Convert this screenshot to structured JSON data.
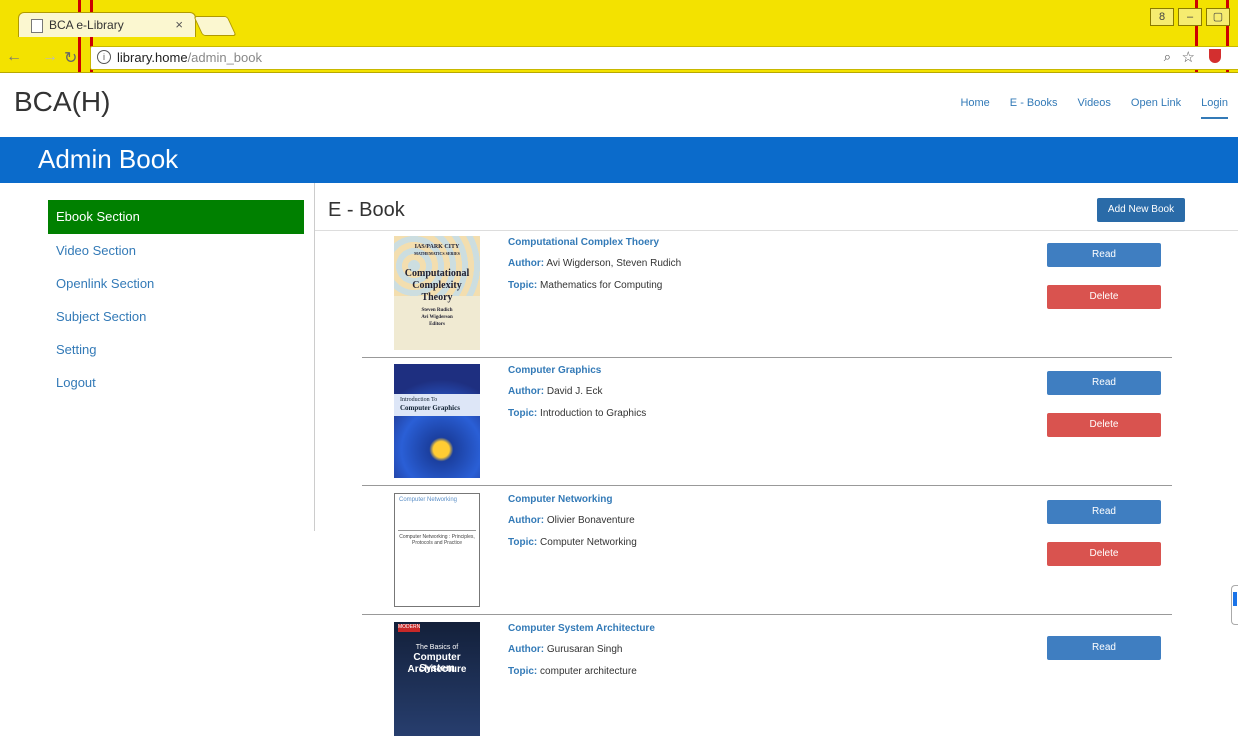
{
  "browser": {
    "tab_title": "BCA e-Library",
    "tab_close": "×",
    "url_host": "library.home",
    "url_path": "/admin_book",
    "info_glyph": "i",
    "window_controls": [
      "8",
      "–",
      "▢"
    ]
  },
  "site": {
    "brand": "BCA(H)",
    "nav": [
      {
        "label": "Home"
      },
      {
        "label": "E - Books"
      },
      {
        "label": "Videos"
      },
      {
        "label": "Open Link"
      },
      {
        "label": "Login"
      }
    ]
  },
  "header": {
    "title": "Admin Book"
  },
  "sidebar": {
    "items": [
      {
        "label": "Ebook Section"
      },
      {
        "label": "Video Section"
      },
      {
        "label": "Openlink Section"
      },
      {
        "label": "Subject Section"
      },
      {
        "label": "Setting"
      },
      {
        "label": "Logout"
      }
    ],
    "active": "Ebook Section"
  },
  "main": {
    "title": "E - Book",
    "add_button": "Add New Book",
    "author_key": "Author:",
    "topic_key": "Topic:",
    "read_label": "Read",
    "delete_label": "Delete",
    "books": [
      {
        "title": "Computational Complex Thoery",
        "author": "Avi Wigderson, Steven Rudich",
        "topic": "Mathematics for Computing",
        "cover_lines": [
          "IAS/PARK CITY",
          "MATHEMATICS SERIES",
          "Computational",
          "Complexity",
          "Theory",
          "Steven Rudich",
          "Avi Wigderson",
          "Editors"
        ]
      },
      {
        "title": "Computer Graphics",
        "author": "David J. Eck",
        "topic": "Introduction to Graphics",
        "cover_lines": [
          "Introduction To",
          "Computer Graphics"
        ]
      },
      {
        "title": "Computer Networking",
        "author": "Olivier Bonaventure",
        "topic": "Computer Networking",
        "cover_lines": [
          "Computer Networking",
          "Computer Networking : Principles, Protocols and Practice"
        ]
      },
      {
        "title": "Computer System Architecture",
        "author": "Gurusaran Singh",
        "topic": "computer architecture",
        "cover_lines": [
          "MODERN",
          "The Basics of",
          "Computer System",
          "Architecture"
        ]
      }
    ]
  },
  "colors": {
    "header_band": "#0b6bcb",
    "active_sidebar": "#008000",
    "read_button": "#3f7ec1",
    "delete_button": "#d9534f",
    "browser_frame": "#f3e200"
  }
}
